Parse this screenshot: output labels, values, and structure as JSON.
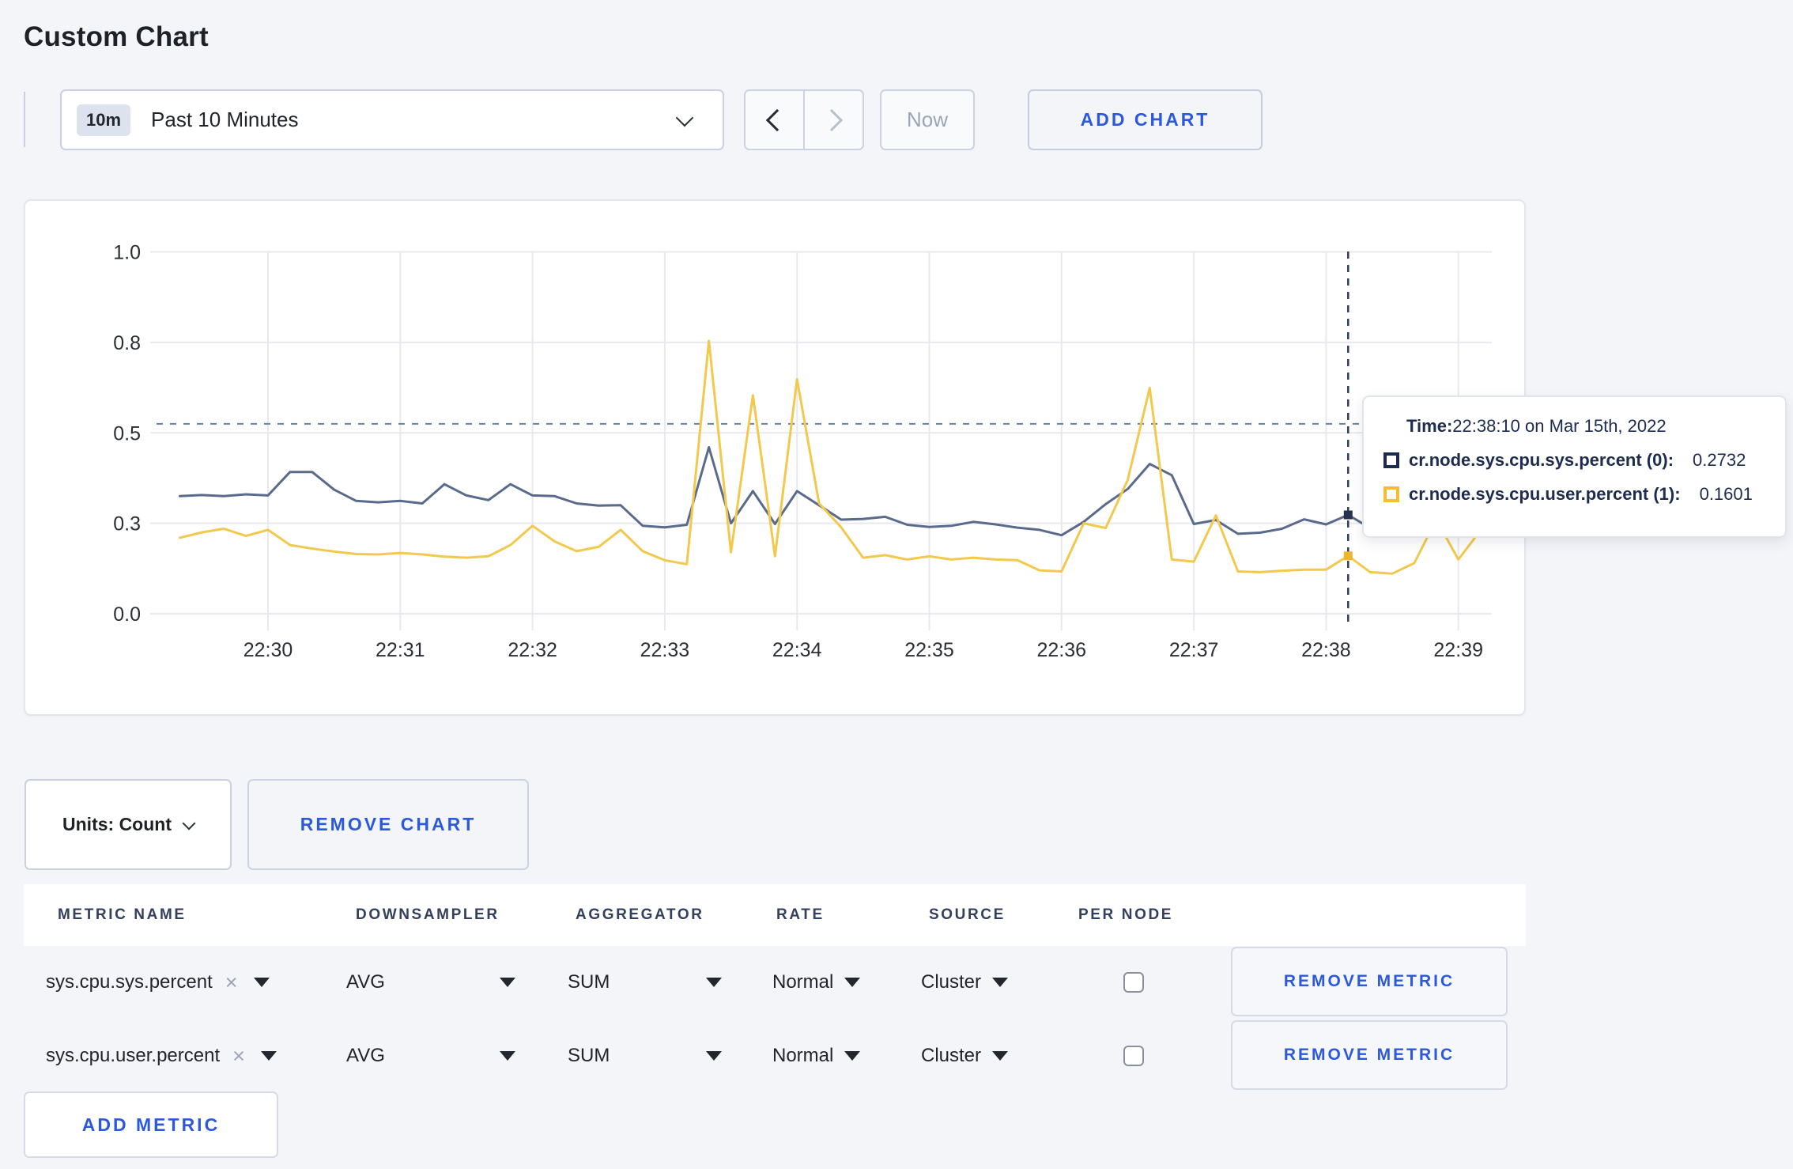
{
  "page": {
    "title": "Custom Chart"
  },
  "toolbar": {
    "time_badge": "10m",
    "time_label": "Past 10 Minutes",
    "now_label": "Now",
    "add_chart_label": "ADD CHART"
  },
  "chart_data": {
    "type": "line",
    "title": "",
    "xlabel": "",
    "ylabel": "",
    "ylim": [
      0,
      1
    ],
    "grid": true,
    "x_start_time": "22:29:20",
    "x_interval_seconds": 10,
    "x_ticks": [
      "22:30",
      "22:31",
      "22:32",
      "22:33",
      "22:34",
      "22:35",
      "22:36",
      "22:37",
      "22:38",
      "22:39"
    ],
    "y_ticks": [
      {
        "value": 0,
        "label": "0.0"
      },
      {
        "value": 0.25,
        "label": "0.3"
      },
      {
        "value": 0.5,
        "label": "0.5"
      },
      {
        "value": 0.75,
        "label": "0.8"
      },
      {
        "value": 1,
        "label": "1.0"
      }
    ],
    "series": [
      {
        "name": "cr.node.sys.cpu.sys.percent (0)",
        "color": "#5a6a8c",
        "marker_color": "#26334f",
        "values": [
          0.325,
          0.328,
          0.325,
          0.33,
          0.327,
          0.392,
          0.392,
          0.343,
          0.312,
          0.308,
          0.312,
          0.305,
          0.358,
          0.327,
          0.314,
          0.358,
          0.327,
          0.325,
          0.305,
          0.299,
          0.3,
          0.243,
          0.239,
          0.246,
          0.46,
          0.25,
          0.339,
          0.248,
          0.339,
          0.3,
          0.26,
          0.262,
          0.268,
          0.246,
          0.24,
          0.243,
          0.254,
          0.247,
          0.238,
          0.232,
          0.217,
          0.254,
          0.303,
          0.345,
          0.414,
          0.383,
          0.248,
          0.259,
          0.221,
          0.224,
          0.235,
          0.261,
          0.247,
          0.2732,
          0.237,
          0.242,
          0.258,
          0.27,
          0.278,
          0.272
        ]
      },
      {
        "name": "cr.node.sys.cpu.user.percent (1)",
        "color": "#f2c94c",
        "marker_color": "#eeb62f",
        "values": [
          0.21,
          0.225,
          0.235,
          0.215,
          0.232,
          0.19,
          0.18,
          0.172,
          0.165,
          0.164,
          0.168,
          0.164,
          0.158,
          0.155,
          0.159,
          0.19,
          0.243,
          0.2,
          0.173,
          0.185,
          0.232,
          0.173,
          0.148,
          0.137,
          0.754,
          0.17,
          0.604,
          0.159,
          0.648,
          0.305,
          0.239,
          0.155,
          0.162,
          0.15,
          0.159,
          0.15,
          0.155,
          0.15,
          0.148,
          0.12,
          0.117,
          0.25,
          0.237,
          0.37,
          0.624,
          0.15,
          0.144,
          0.272,
          0.117,
          0.115,
          0.119,
          0.122,
          0.122,
          0.1601,
          0.115,
          0.111,
          0.14,
          0.26,
          0.15,
          0.23
        ]
      }
    ],
    "legend_position": "tooltip",
    "crosshair": {
      "index": 53,
      "time": "22:38:10",
      "hline_value": 0.525
    }
  },
  "tooltip": {
    "time_label": "Time:",
    "time_value": "22:38:10 on Mar 15th, 2022",
    "series": [
      {
        "label": "cr.node.sys.cpu.sys.percent (0):",
        "value": "0.2732",
        "swatch_color": "#1c2a4e"
      },
      {
        "label": "cr.node.sys.cpu.user.percent (1):",
        "value": "0.1601",
        "swatch_color": "#f6bd33"
      }
    ]
  },
  "chart_controls": {
    "units_label": "Units: Count",
    "remove_chart_label": "REMOVE CHART"
  },
  "metrics_table": {
    "headers": [
      "METRIC NAME",
      "DOWNSAMPLER",
      "AGGREGATOR",
      "RATE",
      "SOURCE",
      "PER NODE"
    ],
    "rows": [
      {
        "metric": "sys.cpu.sys.percent",
        "downsampler": "AVG",
        "aggregator": "SUM",
        "rate": "Normal",
        "source": "Cluster",
        "per_node_checked": false,
        "remove_label": "REMOVE METRIC"
      },
      {
        "metric": "sys.cpu.user.percent",
        "downsampler": "AVG",
        "aggregator": "SUM",
        "rate": "Normal",
        "source": "Cluster",
        "per_node_checked": false,
        "remove_label": "REMOVE METRIC"
      }
    ],
    "add_metric_label": "ADD METRIC"
  }
}
